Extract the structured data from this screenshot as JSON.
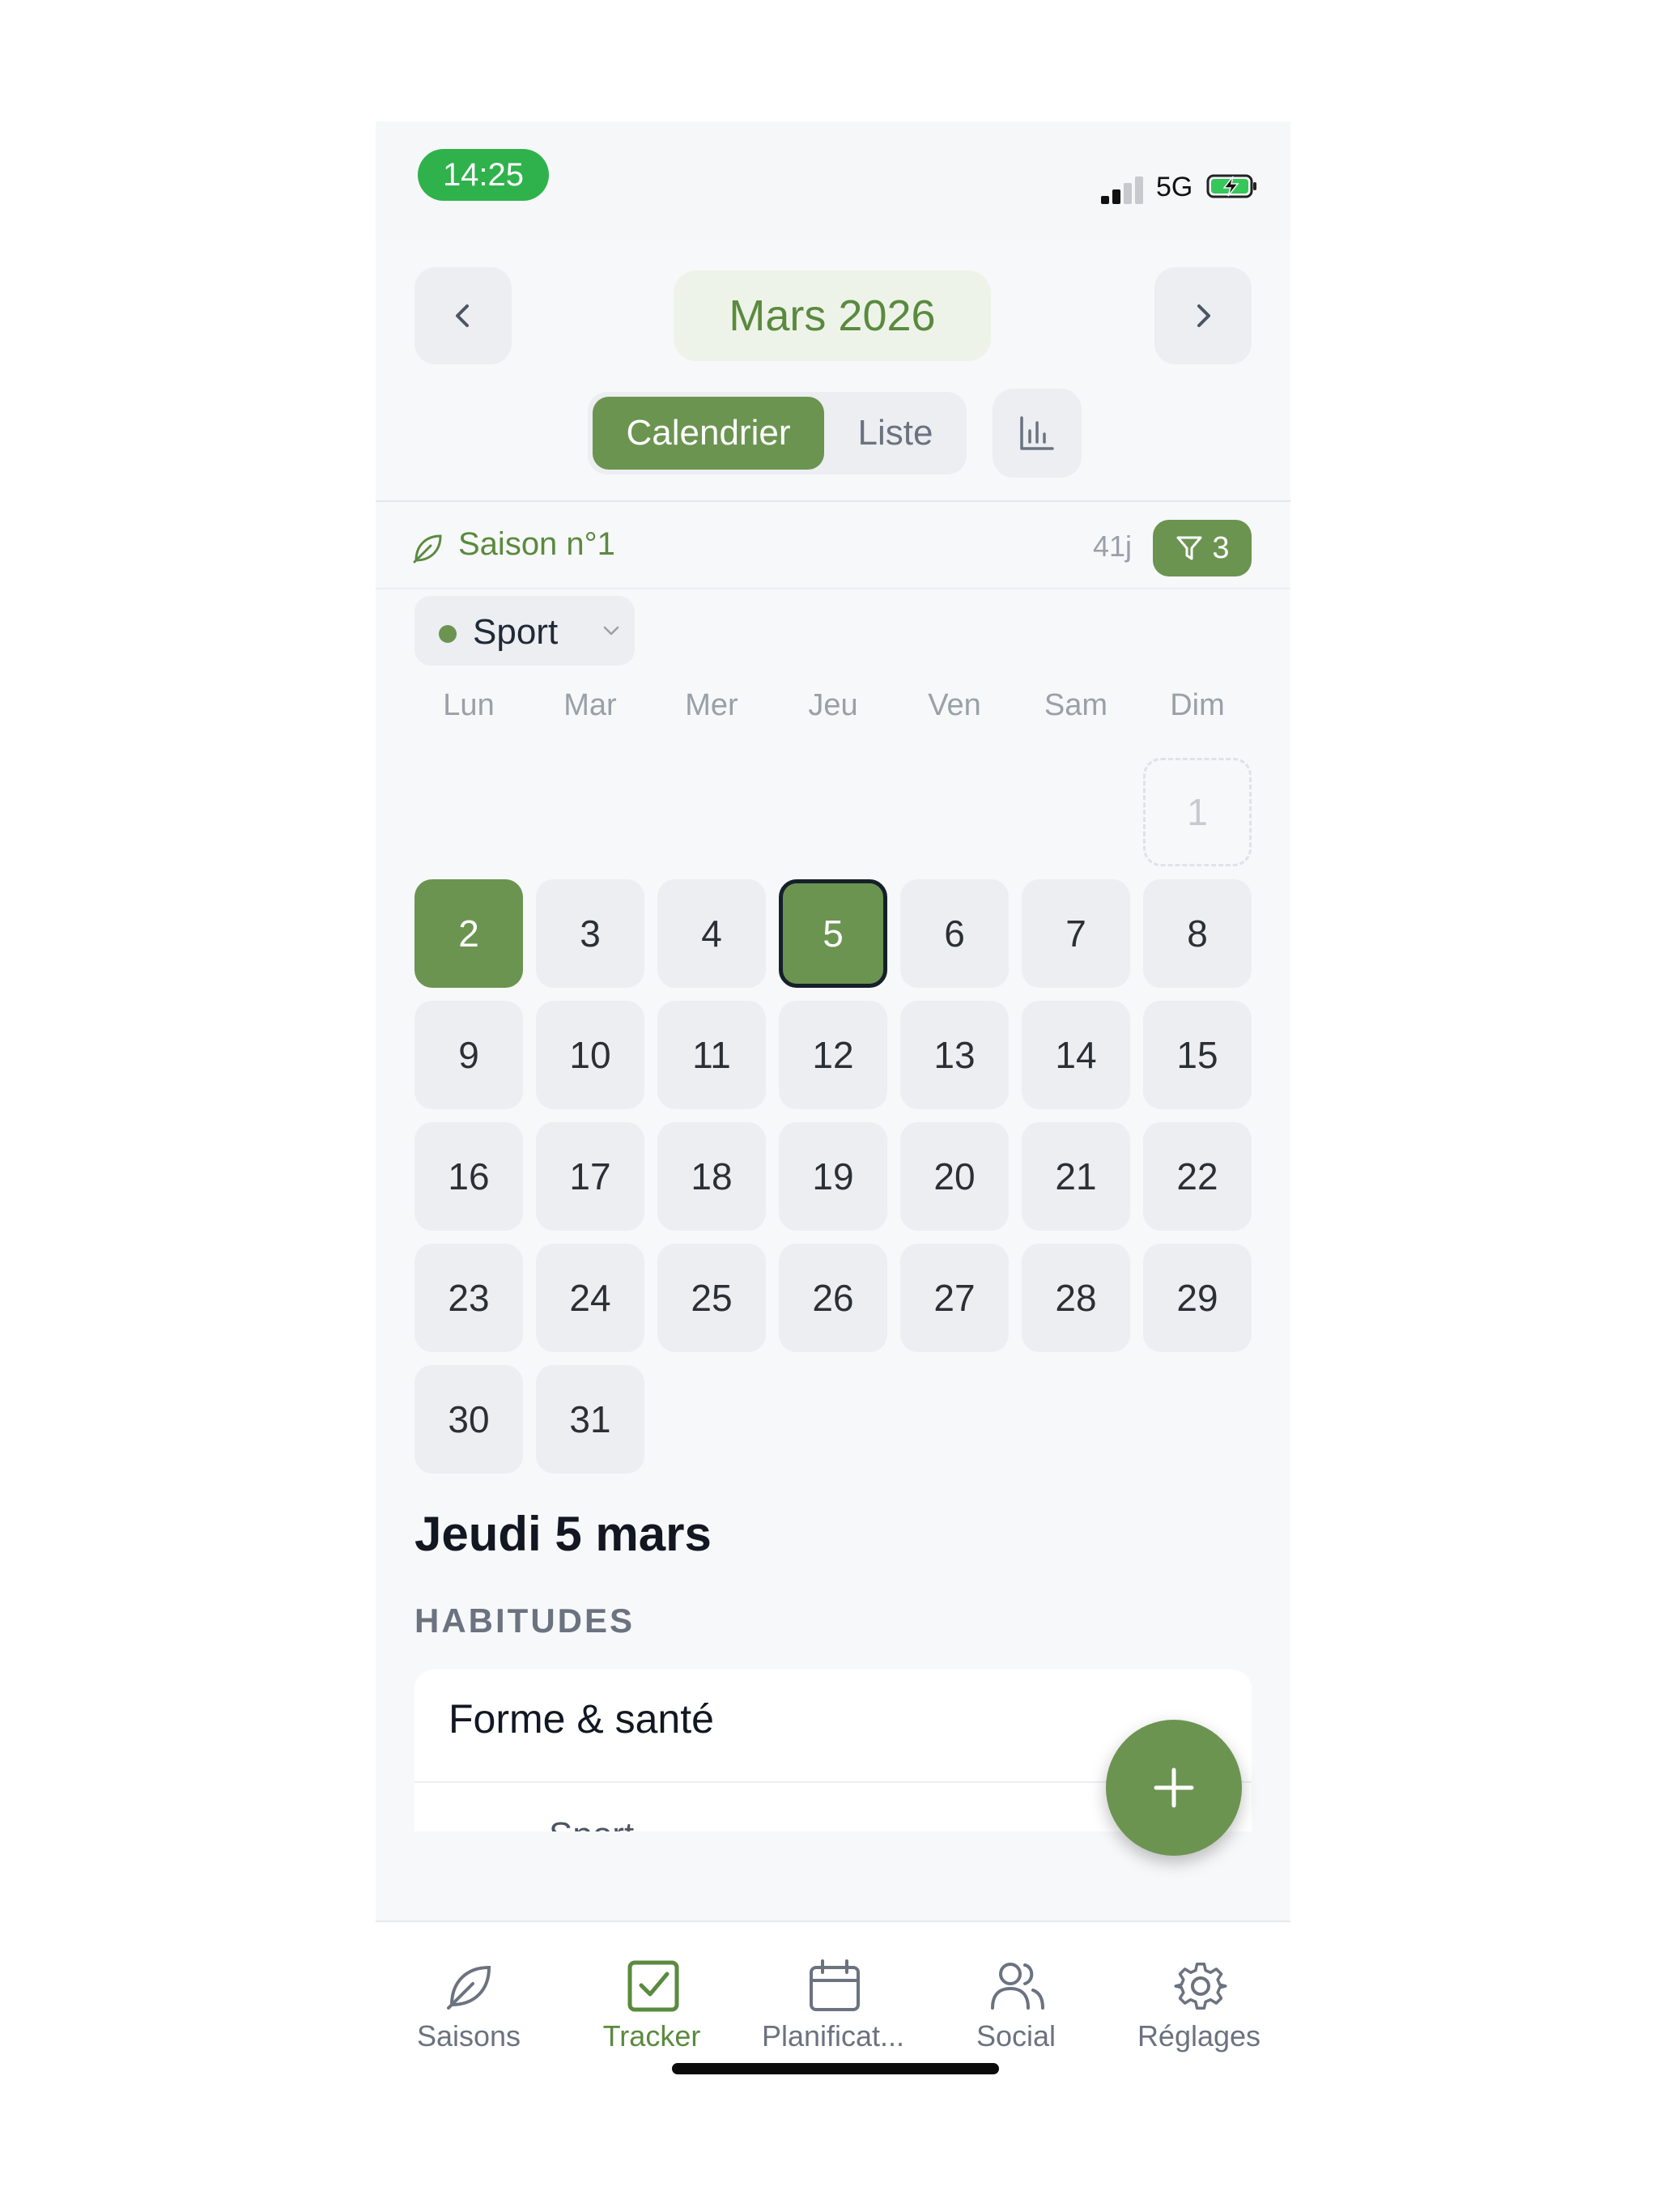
{
  "status": {
    "time": "14:25",
    "network": "5G"
  },
  "header": {
    "month": "Mars 2026"
  },
  "view_toggle": {
    "calendar": "Calendrier",
    "list": "Liste"
  },
  "season": {
    "label": "Saison n°1",
    "days": "41j",
    "filter_count": "3"
  },
  "category_chip": {
    "label": "Sport"
  },
  "calendar": {
    "weekdays": [
      "Lun",
      "Mar",
      "Mer",
      "Jeu",
      "Ven",
      "Sam",
      "Dim"
    ],
    "prev_month_day": "1",
    "days": [
      "2",
      "3",
      "4",
      "5",
      "6",
      "7",
      "8",
      "9",
      "10",
      "11",
      "12",
      "13",
      "14",
      "15",
      "16",
      "17",
      "18",
      "19",
      "20",
      "21",
      "22",
      "23",
      "24",
      "25",
      "26",
      "27",
      "28",
      "29",
      "30",
      "31"
    ],
    "completed": [
      "2"
    ],
    "selected": "5"
  },
  "details": {
    "day_title": "Jeudi 5 mars",
    "section": "HABITUDES",
    "group_title": "Forme & santé",
    "habit_peek": "Sport"
  },
  "colors": {
    "accent": "#6b9450",
    "accent_text": "#5a8a3e",
    "status_pill": "#2fb24c",
    "cell": "#eceef1"
  },
  "tabbar": {
    "items": [
      {
        "label": "Saisons",
        "icon": "leaf-icon"
      },
      {
        "label": "Tracker",
        "icon": "check-square-icon",
        "active": true
      },
      {
        "label": "Planificat...",
        "icon": "calendar-icon"
      },
      {
        "label": "Social",
        "icon": "users-icon"
      },
      {
        "label": "Réglages",
        "icon": "gear-icon"
      }
    ]
  }
}
